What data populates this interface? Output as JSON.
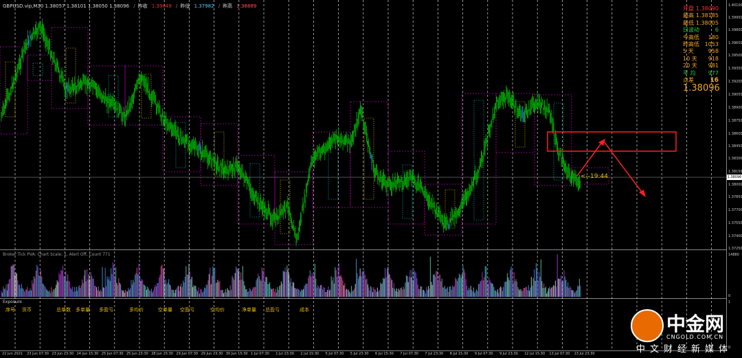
{
  "header": {
    "symbol_info": "GBPUSD.vip,M30  1.38057 1.38101 1.38050 1.38096",
    "prev_close_label": "昨收",
    "prev_close_value": "1.39049",
    "prev_low_label": "昨低",
    "prev_low_value": "1.37982",
    "prev_high_label": "昨高",
    "prev_high_value": "1.38889"
  },
  "stats_panel": {
    "rows": [
      {
        "label": "开盘",
        "value": "1.38090",
        "lc": "#ff3030",
        "vc": "#ff3030"
      },
      {
        "label": "最高",
        "value": "1.38185",
        "lc": "#f5a623",
        "vc": "#f5a623"
      },
      {
        "label": "最低",
        "value": "1.38005",
        "lc": "#f5a623",
        "vc": "#f5a623"
      },
      {
        "label": "日波动",
        "value": "6",
        "lc": "#2ecc40",
        "vc": "#2ecc40"
      },
      {
        "label": "今高低",
        "value": "180",
        "lc": "#f5a623",
        "vc": "#f5a623"
      },
      {
        "label": "昨高低",
        "value": "1053",
        "lc": "#f5a623",
        "vc": "#f5a623"
      },
      {
        "label": "5  天",
        "value": "958",
        "lc": "#f5a623",
        "vc": "#f5a623"
      },
      {
        "label": "10 天",
        "value": "918",
        "lc": "#f5a623",
        "vc": "#f5a623"
      },
      {
        "label": "20 天",
        "value": "981",
        "lc": "#f5a623",
        "vc": "#f5a623"
      },
      {
        "label": "平  均",
        "value": "977",
        "lc": "#2ecc40",
        "vc": "#2ecc40"
      }
    ],
    "spread_label": "点差",
    "spread_value": "16",
    "last_price": "1.38096"
  },
  "price_axis": {
    "ticks": [
      "1.40100",
      "1.39950",
      "1.39800",
      "1.39650",
      "1.39500",
      "1.39350",
      "1.39200",
      "1.39050",
      "1.38900",
      "1.38750",
      "1.38600",
      "1.38450",
      "1.38300",
      "1.38150",
      "1.38096",
      "1.38000",
      "1.37850",
      "1.37700",
      "1.37550",
      "1.37400",
      "1.37250"
    ],
    "current_price": "1.38096"
  },
  "indicator": {
    "label": "Broker Tick PVA:  Chart Scale: 1, Alert Off, Count  771",
    "ticks": [
      "14880",
      "0"
    ]
  },
  "exposure": {
    "title": "Exposure",
    "ticks": [
      "1",
      "0"
    ],
    "headers": [
      "序号",
      "货币",
      "总单数",
      "多单量",
      "多盈亏",
      "多均价",
      "空单量",
      "空盈亏",
      "空均价",
      "净单量",
      "总盈亏",
      "成本"
    ]
  },
  "countdown": "<--19:44",
  "time_axis": {
    "labels": [
      "22 Jun 2021",
      "23 Jun 07:30",
      "23 Jun 23:30",
      "24 Jun 15:30",
      "25 Jun 07:30",
      "25 Jun 23:30",
      "28 Jun 15:30",
      "29 Jun 07:30",
      "29 Jun 23:30",
      "30 Jun 15:30",
      "1 Jul 07:30",
      "1 Jul 23:30",
      "2 Jul 15:30",
      "5 Jul 07:30",
      "5 Jul 23:30",
      "6 Jul 15:30",
      "7 Jul 07:30",
      "7 Jul 23:30",
      "8 Jul 15:30",
      "9 Jul 07:30",
      "9 Jul 23:30",
      "12 Jul 15:30",
      "13 Jul 07:30",
      "13 Jul 23:30"
    ]
  },
  "logo": {
    "brand": "中金网",
    "domain": "CNGOLD.COM.CN",
    "slogan": "中文财经新媒体"
  },
  "colors": {
    "candle_up": "#00c000",
    "candle_down": "#00c000",
    "box_border": "#b000b0",
    "grid": "#ffffff",
    "annotation": "#ff2020",
    "highlight_candle": "#3a7bff"
  },
  "chart_data": {
    "type": "line",
    "title": "",
    "xlabel": "",
    "ylabel": "",
    "ylim": [
      1.3725,
      1.401
    ],
    "series": [
      {
        "name": "",
        "x": [
          "22 Jun 2021",
          "23 Jun 07:30",
          "23 Jun 23:30",
          "24 Jun 15:30",
          "25 Jun 07:30",
          "25 Jun 23:30",
          "28 Jun 15:30",
          "29 Jun 07:30",
          "29 Jun 23:30",
          "30 Jun 15:30",
          "1 Jul 07:30",
          "1 Jul 23:30",
          "2 Jul 15:30",
          "5 Jul 07:30",
          "5 Jul 23:30",
          "6 Jul 15:30",
          "7 Jul 07:30",
          "7 Jul 23:30",
          "8 Jul 15:30",
          "9 Jul 07:30",
          "9 Jul 23:30",
          "12 Jul 15:30",
          "13 Jul 07:30",
          "13 Jul 23:30"
        ],
        "values": [
          1.392,
          1.3975,
          1.395,
          1.388,
          1.386,
          1.39,
          1.387,
          1.385,
          1.383,
          1.381,
          1.377,
          1.376,
          1.384,
          1.388,
          1.381,
          1.382,
          1.38,
          1.379,
          1.378,
          1.383,
          1.389,
          1.388,
          1.385,
          1.381
        ]
      }
    ]
  }
}
